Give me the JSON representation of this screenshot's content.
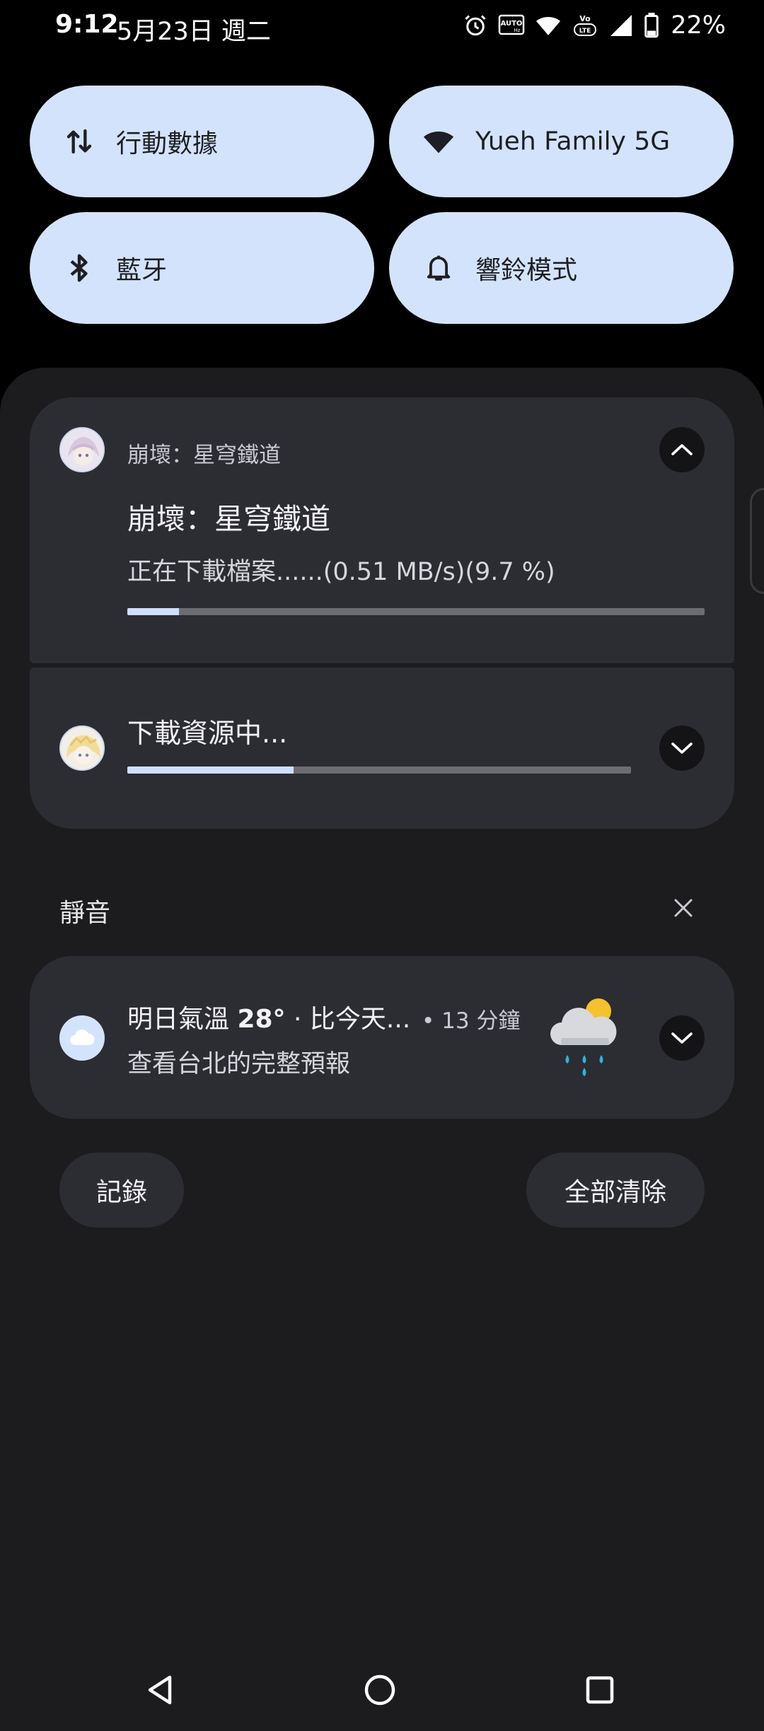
{
  "status_bar": {
    "time": "9:12",
    "date": "5月23日 週二",
    "battery_percent": "22%",
    "icons": [
      "alarm-icon",
      "auto-hz-icon",
      "wifi-icon",
      "volte-icon",
      "signal-icon",
      "battery-icon"
    ]
  },
  "quick_settings": {
    "tiles": [
      {
        "label": "行動數據",
        "icon": "mobile-data-icon"
      },
      {
        "label": "Yueh Family 5G",
        "icon": "wifi-icon"
      },
      {
        "label": "藍牙",
        "icon": "bluetooth-icon"
      },
      {
        "label": "響鈴模式",
        "icon": "bell-icon"
      }
    ],
    "tile_color": "#d4e3fc"
  },
  "notifications": {
    "download": {
      "app_name": "崩壞：星穹鐵道",
      "title": "崩壞：星穹鐵道",
      "text": "正在下載檔案......(0.51 MB/s)(9.7 %)",
      "progress": 0.089
    },
    "resources": {
      "title": "下載資源中...",
      "progress": 0.33
    }
  },
  "silent_section": {
    "title": "靜音",
    "weather": {
      "title_prefix": "明日氣溫 ",
      "title_temp": "28°",
      "title_suffix": " · 比今天...",
      "time": "• 13 分鐘",
      "subtitle": "查看台北的完整預報"
    }
  },
  "actions": {
    "history": "記錄",
    "clear_all": "全部清除"
  },
  "colors": {
    "background": "#000000",
    "shade": "#1c1c1e",
    "card": "#2c2c33",
    "accent": "#cfe0ff"
  }
}
